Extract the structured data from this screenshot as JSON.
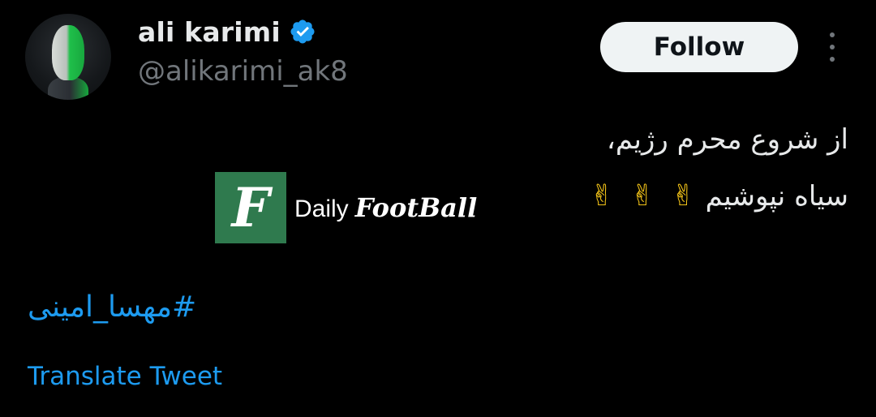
{
  "author": {
    "display_name": "ali karimi",
    "handle": "@alikarimi_ak8",
    "verified": true,
    "avatar_icon": "profile-photo"
  },
  "header": {
    "follow_label": "Follow",
    "more_icon": "more-vertical-icon"
  },
  "tweet": {
    "line1": "از شروع محرم رژیم،",
    "line2": "سیاه نپوشیم",
    "emojis": [
      "✌",
      "✌",
      "✌"
    ],
    "hashtag": "#مهسا_امینی",
    "translate_label": "Translate Tweet"
  },
  "watermark": {
    "logo_letter": "F",
    "daily": "Daily",
    "football": "FootBall"
  },
  "colors": {
    "background": "#000000",
    "text": "#e7e9ea",
    "secondary": "#71767b",
    "link": "#1d9bf0",
    "verified": "#1d9bf0",
    "follow_bg": "#eff3f4"
  }
}
